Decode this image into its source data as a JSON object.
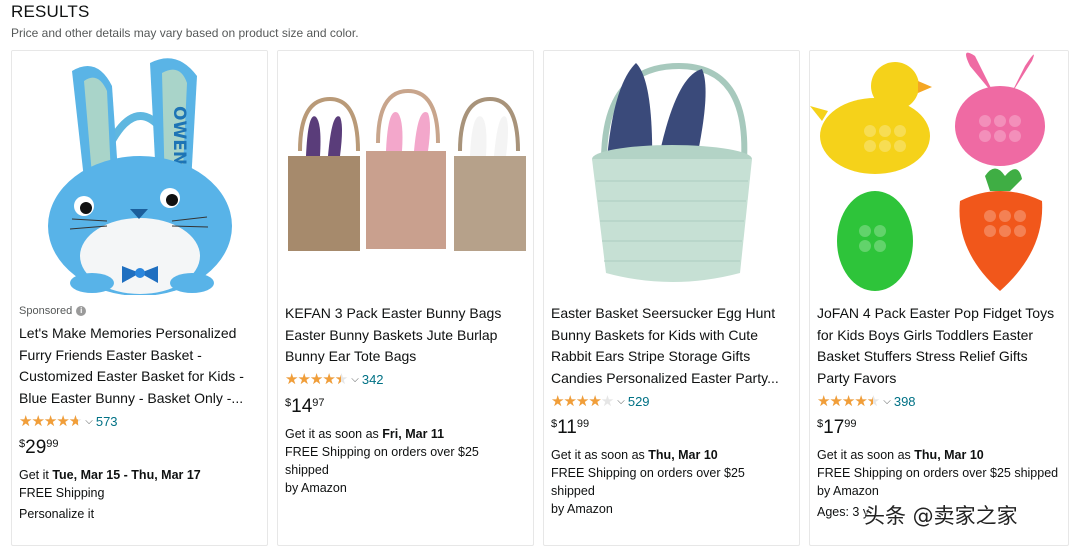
{
  "header": {
    "title": "RESULTS",
    "subtitle": "Price and other details may vary based on product size and color."
  },
  "products": [
    {
      "sponsored": "Sponsored",
      "title_lines": [
        "Let's Make Memories Personalized",
        "Furry Friends Easter Basket -",
        "Customized Easter Basket for Kids -",
        "Blue Easter Bunny - Basket Only -..."
      ],
      "rating_fraction": 0.95,
      "rating_count": "573",
      "price_symbol": "$",
      "price_whole": "29",
      "price_fraction": "99",
      "delivery_prefix": "Get it ",
      "delivery_date": "Tue, Mar 15 - Thu, Mar 17",
      "shipping_line1": "FREE Shipping",
      "shipping_line2": "",
      "extra": "Personalize it",
      "image_name_text": "OWEN"
    },
    {
      "title_lines": [
        "KEFAN 3 Pack Easter Bunny Bags",
        "Easter Bunny Baskets Jute Burlap",
        "Bunny Ear Tote Bags"
      ],
      "rating_fraction": 0.9,
      "rating_count": "342",
      "price_symbol": "$",
      "price_whole": "14",
      "price_fraction": "97",
      "delivery_prefix": "Get it as soon as ",
      "delivery_date": "Fri, Mar 11",
      "shipping_line1": "FREE Shipping on orders over $25 shipped",
      "shipping_line2": "by Amazon"
    },
    {
      "title_lines": [
        "Easter Basket Seersucker Egg Hunt",
        "Bunny Baskets for Kids with Cute",
        "Rabbit Ears Stripe Storage Gifts",
        "Candies Personalized Easter Party..."
      ],
      "rating_fraction": 0.8,
      "rating_count": "529",
      "price_symbol": "$",
      "price_whole": "11",
      "price_fraction": "99",
      "delivery_prefix": "Get it as soon as ",
      "delivery_date": "Thu, Mar 10",
      "shipping_line1": "FREE Shipping on orders over $25 shipped",
      "shipping_line2": "by Amazon"
    },
    {
      "title_lines": [
        "JoFAN 4 Pack Easter Pop Fidget Toys",
        "for Kids Boys Girls Toddlers Easter",
        "Basket Stuffers Stress Relief Gifts",
        "Party Favors"
      ],
      "rating_fraction": 0.9,
      "rating_count": "398",
      "price_symbol": "$",
      "price_whole": "17",
      "price_fraction": "99",
      "delivery_prefix": "Get it as soon as ",
      "delivery_date": "Thu, Mar 10",
      "shipping_line1": "FREE Shipping on orders over $25 shipped",
      "shipping_line2": "by Amazon",
      "extra": "Ages: 3 y"
    }
  ],
  "colors": {
    "star": "#f19e39",
    "link": "#007185",
    "muted": "#565959"
  },
  "watermark": "头条 @卖家之家"
}
